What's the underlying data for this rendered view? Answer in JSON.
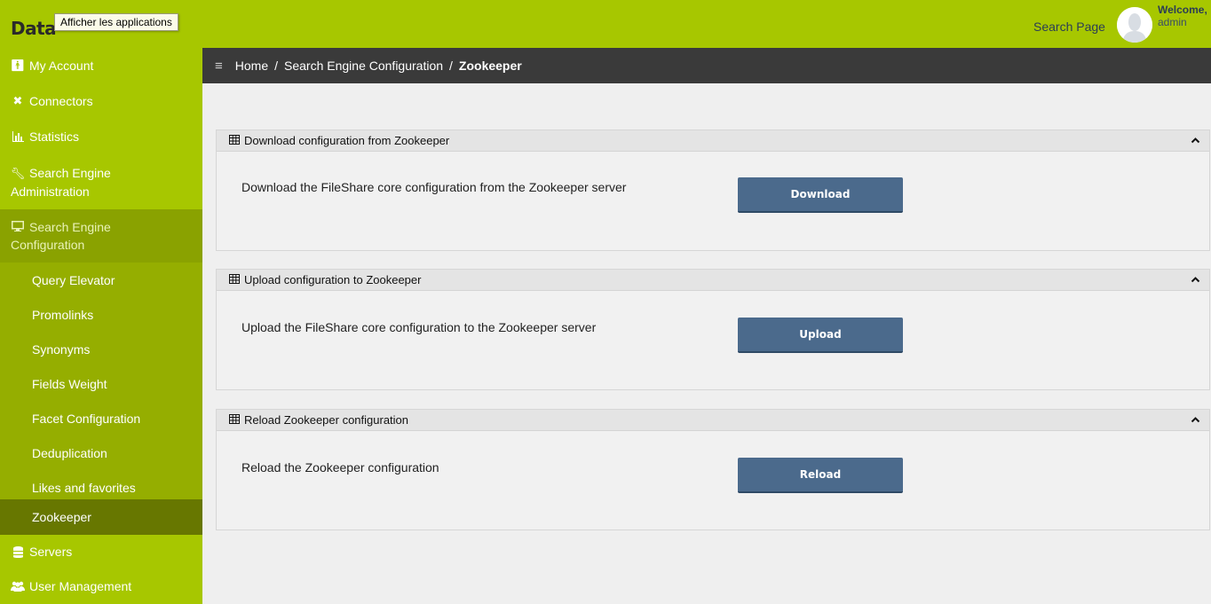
{
  "header": {
    "logo_text": "Data",
    "tooltip": "Afficher les applications",
    "search_link": "Search Page",
    "welcome_title": "Welcome,",
    "welcome_user": "admin",
    "brand_color": "#a7c700"
  },
  "sidebar": {
    "items": [
      {
        "label": "My Account",
        "icon": "person-icon"
      },
      {
        "label": "Connectors",
        "icon": "cross-arrows-icon"
      },
      {
        "label": "Statistics",
        "icon": "bar-chart-icon"
      },
      {
        "label_line1": "Search Engine",
        "label_line2": "Administration",
        "icon": "wrench-icon"
      },
      {
        "label_line1": "Search Engine",
        "label_line2": "Configuration",
        "icon": "monitor-icon"
      }
    ],
    "sub_items": [
      {
        "label": "Query Elevator"
      },
      {
        "label": "Promolinks"
      },
      {
        "label": "Synonyms"
      },
      {
        "label": "Fields Weight"
      },
      {
        "label": "Facet Configuration"
      },
      {
        "label": "Deduplication"
      },
      {
        "label": "Likes and favorites"
      },
      {
        "label": "Zookeeper",
        "current": true
      }
    ],
    "bottom_items": [
      {
        "label": "Servers",
        "icon": "database-icon"
      },
      {
        "label": "User Management",
        "icon": "users-icon"
      }
    ]
  },
  "breadcrumb": {
    "home": "Home",
    "sep1": "/",
    "section": "Search Engine Configuration",
    "sep2": "/",
    "current": "Zookeeper"
  },
  "panels": [
    {
      "title": "Download configuration from Zookeeper",
      "description": "Download the FileShare core configuration from the Zookeeper server",
      "button": "Download"
    },
    {
      "title": "Upload configuration to Zookeeper",
      "description": "Upload the FileShare core configuration to the Zookeeper server",
      "button": "Upload"
    },
    {
      "title": "Reload Zookeeper configuration",
      "description": "Reload the Zookeeper configuration",
      "button": "Reload"
    }
  ]
}
